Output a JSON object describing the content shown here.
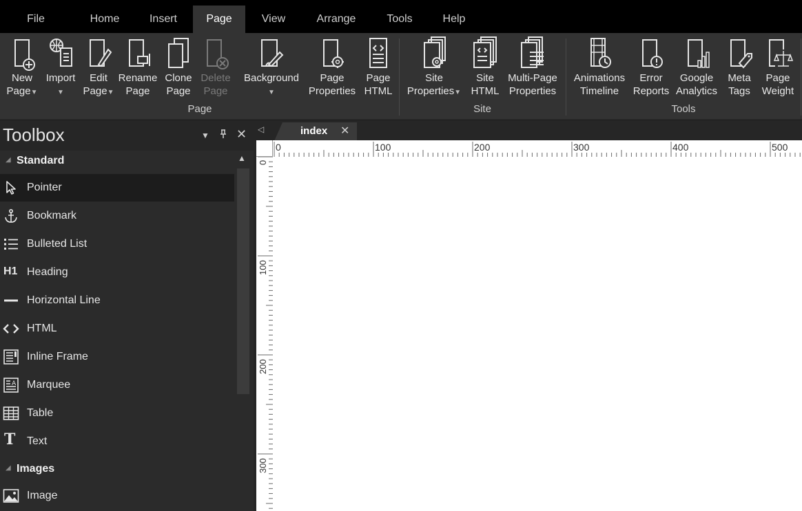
{
  "menu": {
    "tabs": [
      {
        "label": "File"
      },
      {
        "label": "Home"
      },
      {
        "label": "Insert"
      },
      {
        "label": "Page"
      },
      {
        "label": "View"
      },
      {
        "label": "Arrange"
      },
      {
        "label": "Tools"
      },
      {
        "label": "Help"
      }
    ],
    "active": "Page"
  },
  "ribbon": {
    "groups": {
      "page": "Page",
      "site": "Site",
      "tools": "Tools"
    },
    "buttons": {
      "new_page": {
        "l1": "New",
        "l2": "Page"
      },
      "import": {
        "l1": "Import"
      },
      "edit_page": {
        "l1": "Edit",
        "l2": "Page"
      },
      "rename_page": {
        "l1": "Rename",
        "l2": "Page"
      },
      "clone_page": {
        "l1": "Clone",
        "l2": "Page"
      },
      "delete_page": {
        "l1": "Delete",
        "l2": "Page"
      },
      "background": {
        "l1": "Background"
      },
      "page_properties": {
        "l1": "Page",
        "l2": "Properties"
      },
      "page_html": {
        "l1": "Page",
        "l2": "HTML"
      },
      "site_properties": {
        "l1": "Site",
        "l2": "Properties"
      },
      "site_html": {
        "l1": "Site",
        "l2": "HTML"
      },
      "multi_page_properties": {
        "l1": "Multi-Page",
        "l2": "Properties"
      },
      "animations_timeline": {
        "l1": "Animations",
        "l2": "Timeline"
      },
      "error_reports": {
        "l1": "Error",
        "l2": "Reports"
      },
      "google_analytics": {
        "l1": "Google",
        "l2": "Analytics"
      },
      "meta_tags": {
        "l1": "Meta",
        "l2": "Tags"
      },
      "page_weight": {
        "l1": "Page",
        "l2": "Weight"
      }
    },
    "dropdown_glyph": "▼"
  },
  "toolbox": {
    "title": "Toolbox",
    "controls": {
      "menu": "▼",
      "pin": "⊥",
      "close": "✕"
    },
    "categories": {
      "standard": "Standard",
      "images": "Images"
    },
    "items": [
      {
        "label": "Pointer",
        "icon": "pointer-icon"
      },
      {
        "label": "Bookmark",
        "icon": "anchor-icon"
      },
      {
        "label": "Bulleted List",
        "icon": "bulleted-list-icon"
      },
      {
        "label": "Heading",
        "icon": "heading-icon",
        "glyph": "H1"
      },
      {
        "label": "Horizontal Line",
        "icon": "horizontal-line-icon"
      },
      {
        "label": "HTML",
        "icon": "html-icon",
        "glyph": "<>"
      },
      {
        "label": "Inline Frame",
        "icon": "inline-frame-icon"
      },
      {
        "label": "Marquee",
        "icon": "marquee-icon"
      },
      {
        "label": "Table",
        "icon": "table-icon"
      },
      {
        "label": "Text",
        "icon": "text-icon",
        "glyph": "T"
      },
      {
        "label": "Image",
        "icon": "image-icon"
      }
    ],
    "selected": "Pointer"
  },
  "document": {
    "tab_label": "index",
    "tab_close": "✕",
    "tab_scroll": "◁",
    "hruler_labels": [
      "0",
      "100",
      "200",
      "300",
      "400",
      "500"
    ],
    "vruler_labels": [
      "0",
      "100",
      "200",
      "300"
    ]
  }
}
